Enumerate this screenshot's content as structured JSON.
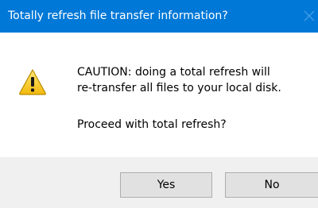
{
  "window": {
    "title": "Totally refresh file transfer information?",
    "close_icon": "close-icon",
    "titlebar_color": "#0078d7"
  },
  "message": {
    "icon": "warning-icon",
    "line1": "CAUTION: doing a total refresh will",
    "line2": "re-transfer all files to your local disk.",
    "question": "Proceed with total refresh?"
  },
  "buttons": {
    "yes_label": "Yes",
    "no_label": "No"
  }
}
